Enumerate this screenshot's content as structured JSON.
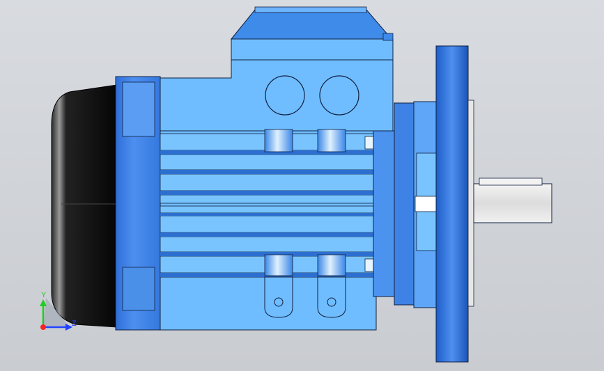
{
  "viewport": {
    "model": "electric-motor-flange-mounted",
    "view": "side"
  },
  "triad": {
    "y_label": "Y",
    "z_label": "Z",
    "colors": {
      "y": "#22cc22",
      "z": "#2244ff",
      "x": "#ff2222"
    }
  },
  "colors": {
    "body": "#6fbdff",
    "body_dark": "#3f8fe0",
    "flange": "#2b6fd6",
    "fan_cover": "#111111",
    "shaft": "#e8e8e8",
    "outline": "#102040"
  }
}
